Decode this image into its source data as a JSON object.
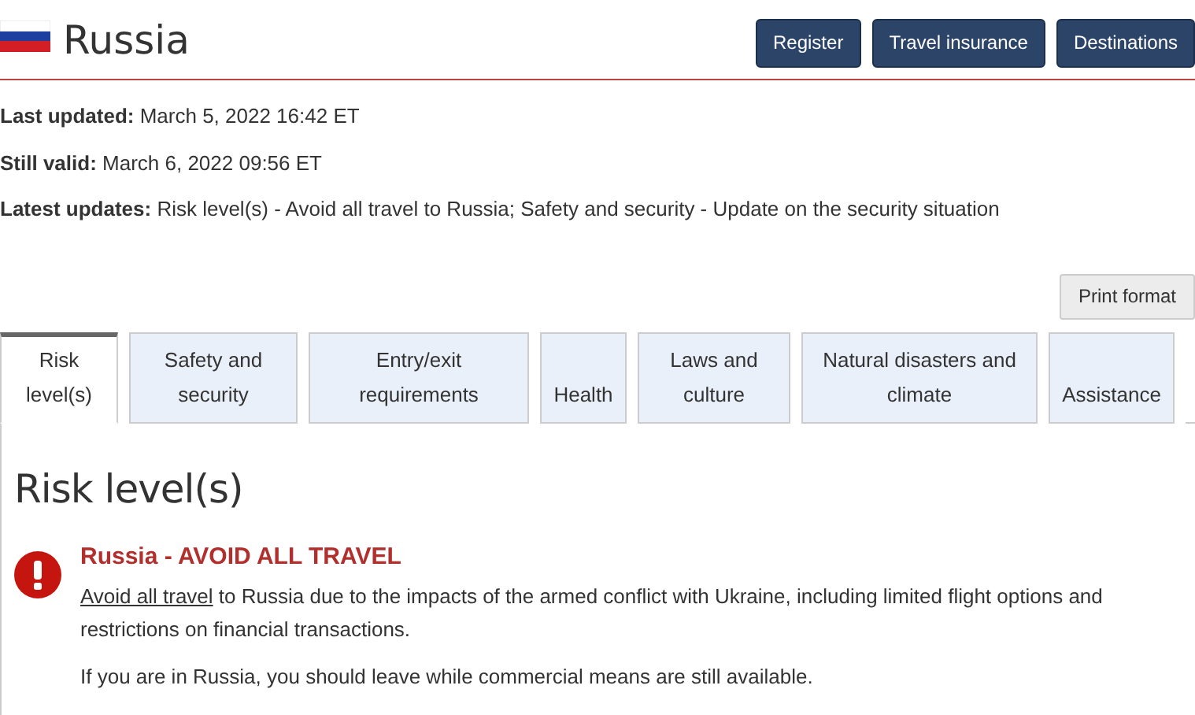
{
  "header": {
    "title": "Russia",
    "buttons": [
      "Register",
      "Travel insurance",
      "Destinations"
    ]
  },
  "meta": [
    {
      "label": "Last updated:",
      "value": "March 5, 2022 16:42 ET"
    },
    {
      "label": "Still valid:",
      "value": "March 6, 2022 09:56 ET"
    },
    {
      "label": "Latest updates:",
      "value": "Risk level(s) - Avoid all travel to Russia; Safety and security - Update on the security situation"
    }
  ],
  "print_button": "Print format",
  "tabs": [
    {
      "label": "Risk level(s)",
      "selected": true
    },
    {
      "label": "Safety and security",
      "selected": false
    },
    {
      "label": "Entry/exit requirements",
      "selected": false
    },
    {
      "label": "Health",
      "selected": false
    },
    {
      "label": "Laws and culture",
      "selected": false
    },
    {
      "label": "Natural disasters and climate",
      "selected": false
    },
    {
      "label": "Assistance",
      "selected": false
    }
  ],
  "panel": {
    "heading": "Risk level(s)",
    "alert": {
      "title": "Russia - AVOID ALL TRAVEL",
      "link": "Avoid all travel",
      "text": " to Russia due to the impacts of the armed conflict with Ukraine, including limited flight options and restrictions on financial transactions.",
      "note": "If you are in Russia, you should leave while commercial means are still available."
    }
  }
}
